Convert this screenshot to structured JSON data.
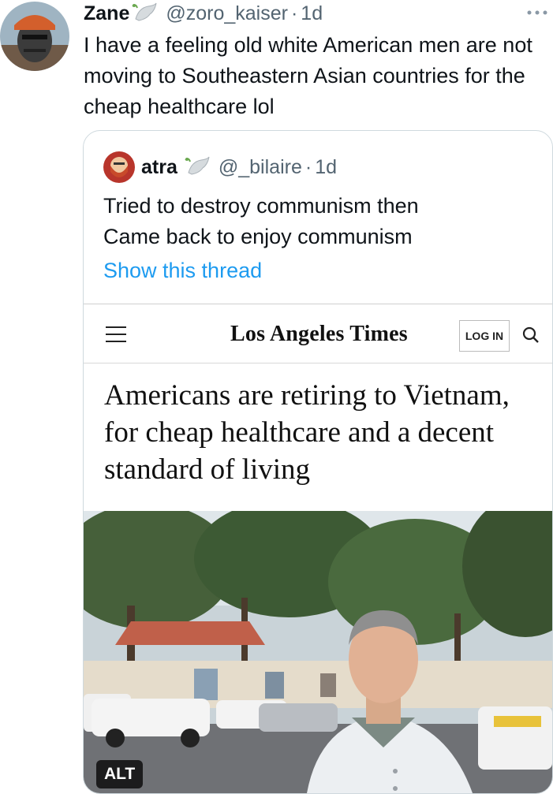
{
  "tweet": {
    "display_name": "Zane",
    "handle": "@zoro_kaiser",
    "dot": "·",
    "time": "1d",
    "text": "I have a feeling old white American men are not moving to Southeastern Asian countries for the cheap healthcare lol",
    "icons": [
      "avatar",
      "dove-icon",
      "more-icon"
    ]
  },
  "quote": {
    "display_name": "atra",
    "handle": "@_bilaire",
    "dot": "·",
    "time": "1d",
    "text_line_1": "Tried to destroy communism then",
    "text_line_2": "Came back to enjoy communism",
    "show_thread": "Show this thread"
  },
  "article": {
    "logo": "Los Angeles Times",
    "login_label": "LOG IN",
    "headline": "Americans are retiring to Vietnam, for cheap healthcare and a decent standard of living",
    "alt_label": "ALT"
  },
  "colors": {
    "text": "#0f1419",
    "secondary": "#536471",
    "link": "#1d9bf0",
    "border": "#cfd9de"
  }
}
